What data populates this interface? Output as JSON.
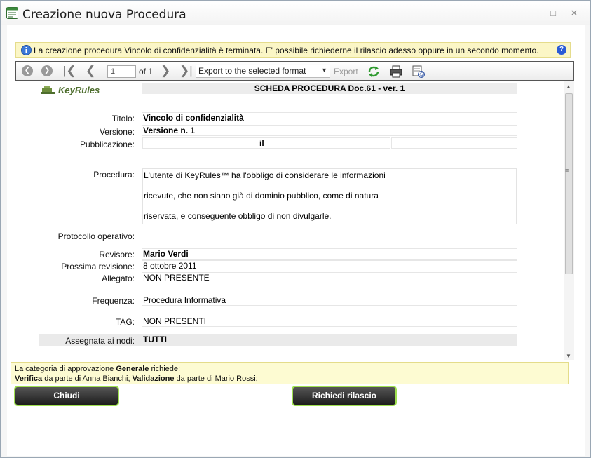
{
  "window": {
    "title": "Creazione nuova Procedura"
  },
  "info_bar": {
    "message": "La creazione procedura Vincolo di confidenzialità è terminata. E' possibile richiederne il rilascio adesso oppure in un secondo momento."
  },
  "toolbar": {
    "page_value": "1",
    "page_of": "of 1",
    "export_format": "Export to the selected format",
    "export_label": "Export",
    "icons": [
      "first-circle-icon",
      "prev-circle-icon",
      "first-page-icon",
      "prev-page-icon",
      "next-page-icon",
      "last-page-icon",
      "refresh-icon",
      "print-icon",
      "email-icon"
    ]
  },
  "report": {
    "logo_text": "KeyRules",
    "sheet_title": "SCHEDA PROCEDURA Doc.61 - ver. 1",
    "labels": {
      "titolo": "Titolo:",
      "versione": "Versione:",
      "pubblicazione": "Pubblicazione:",
      "procedura": "Procedura:",
      "protocollo": "Protocollo operativo:",
      "revisore": "Revisore:",
      "prossima_revisione": "Prossima revisione:",
      "allegato": "Allegato:",
      "frequenza": "Frequenza:",
      "tag": "TAG:",
      "assegnata": "Assegnata ai nodi:"
    },
    "values": {
      "titolo": "Vincolo di confidenzialità",
      "versione": "Versione n. 1",
      "pubblicazione_il": "il",
      "procedura_lines": [
        "L'utente di KeyRules™ ha l'obbligo di considerare le informazioni",
        "ricevute, che non siano già di dominio pubblico, come di natura",
        "riservata, e conseguente obbligo di non divulgarle."
      ],
      "revisore": "Mario Verdi",
      "prossima_revisione": "8 ottobre 2011",
      "allegato": "NON PRESENTE",
      "frequenza": "Procedura Informativa",
      "tag": "NON PRESENTI",
      "assegnata": "TUTTI"
    }
  },
  "approval": {
    "line1_prefix": "La categoria di approvazione ",
    "line1_category": "Generale",
    "line1_suffix": " richiede:",
    "verifica_label": "Verifica",
    "verifica_text": " da parte di Anna Bianchi; ",
    "validazione_label": "Validazione",
    "validazione_text": " da parte di Mario Rossi;"
  },
  "buttons": {
    "close": "Chiudi",
    "request_release": "Richiedi rilascio"
  },
  "colors": {
    "button_border": "#9fe050",
    "info_bg": "#fbf6c6",
    "logo_green": "#4e6e2e"
  }
}
